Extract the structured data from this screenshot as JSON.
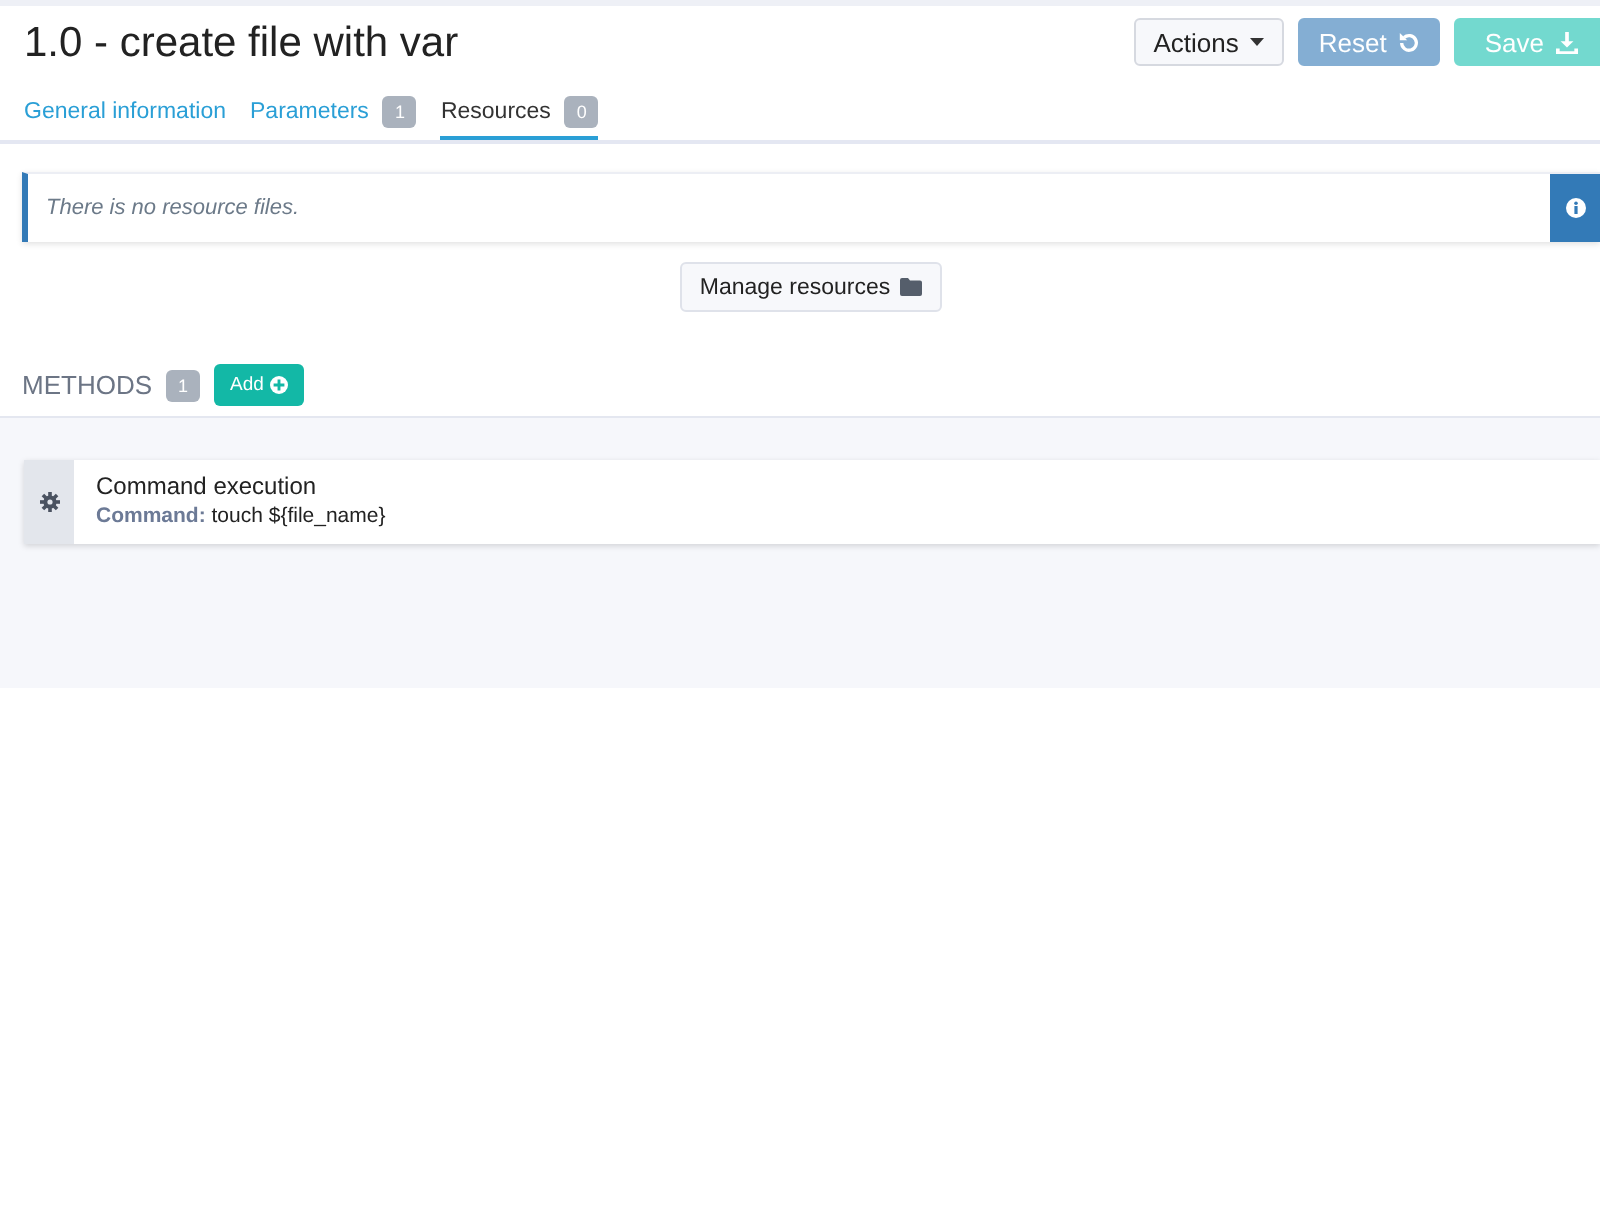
{
  "header": {
    "title": "1.0 - create file with var",
    "buttons": [
      {
        "kind": "dropdown",
        "label": "Actions",
        "disabled": false
      },
      {
        "kind": "reset",
        "label": "Reset",
        "disabled": true
      },
      {
        "kind": "save",
        "label": "Save",
        "disabled": true
      }
    ]
  },
  "tabs": [
    {
      "label": "General information",
      "selected": false
    },
    {
      "label": "Parameters",
      "count": "1",
      "selected": false
    },
    {
      "label": "Resources",
      "count": "0",
      "selected": true
    }
  ],
  "resources": {
    "message": "There is no resource files.",
    "button": "Manage resources"
  },
  "methods": {
    "title": "METHODS",
    "count": "1",
    "add_button": "Add",
    "items": [
      {
        "name": "Command execution",
        "detail": "**Command:** touch ${file_name}"
      }
    ]
  }
}
